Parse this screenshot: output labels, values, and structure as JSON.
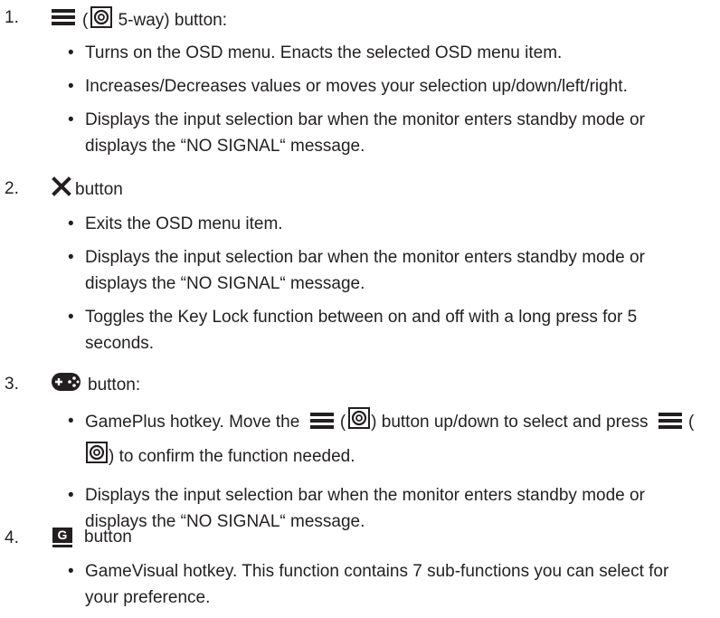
{
  "items": [
    {
      "number": "1.",
      "icon": "menu-lines-icon",
      "head_open": "(",
      "head_icon2": "five-way-joystick-icon",
      "head_text": " 5-way) button:",
      "bullets": [
        "Turns on the OSD menu. Enacts the selected OSD menu item.",
        "Increases/Decreases values or moves your selection up/down/left/right.",
        "Displays the input selection bar when the monitor  enters standby mode or displays the “NO SIGNAL“ message."
      ]
    },
    {
      "number": "2.",
      "icon": "close-x-icon",
      "head_text": "button",
      "bullets": [
        "Exits the OSD menu item.",
        "Displays the input selection bar when the monitor  enters standby mode or displays the “NO SIGNAL“ message.",
        "Toggles the Key Lock function between on and off with a long press for 5 seconds."
      ]
    },
    {
      "number": "3.",
      "icon": "gamepad-icon",
      "head_text": "button:",
      "bullets": [
        {
          "p1": "GamePlus hotkey. Move the",
          "p2": ") button up/down to select and press",
          "p3": ") to confirm the function needed."
        },
        "Displays the input selection bar when the monitor  enters standby mode or displays the “NO SIGNAL“ message."
      ]
    },
    {
      "number": "4.",
      "icon": "gamevisual-g-icon",
      "icon_letter": "G",
      "head_text": "button",
      "bullets": [
        "GameVisual hotkey. This function contains 7 sub-functions you can select for your preference."
      ]
    }
  ]
}
